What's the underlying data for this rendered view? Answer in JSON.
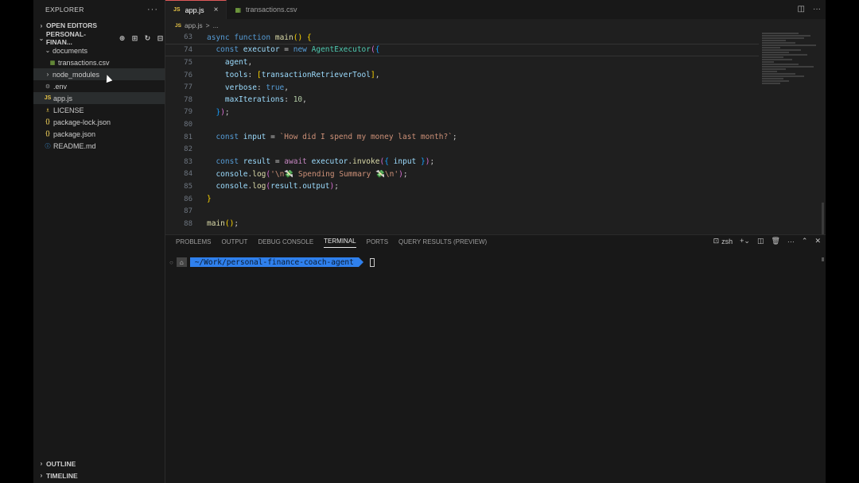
{
  "sidebar": {
    "title": "EXPLORER",
    "more": "···",
    "open_editors": "OPEN EDITORS",
    "project": "PERSONAL-FINAN...",
    "tree": [
      {
        "label": "documents",
        "type": "folder-open",
        "icon": "",
        "indent": 1
      },
      {
        "label": "transactions.csv",
        "type": "file",
        "icon": "▦",
        "indent": 2
      },
      {
        "label": "node_modules",
        "type": "folder-closed",
        "icon": "",
        "indent": 1
      },
      {
        "label": ".env",
        "type": "file",
        "icon": "⚙",
        "indent": 1
      },
      {
        "label": "app.js",
        "type": "file",
        "icon": "JS",
        "indent": 1
      },
      {
        "label": "LICENSE",
        "type": "file",
        "icon": "♗",
        "indent": 1
      },
      {
        "label": "package-lock.json",
        "type": "file",
        "icon": "{}",
        "indent": 1
      },
      {
        "label": "package.json",
        "type": "file",
        "icon": "{}",
        "indent": 1
      },
      {
        "label": "README.md",
        "type": "file",
        "icon": "ⓘ",
        "indent": 1
      }
    ],
    "outline": "OUTLINE",
    "timeline": "TIMELINE"
  },
  "tabs": [
    {
      "label": "app.js",
      "icon": "JS",
      "active": true,
      "close": "×"
    },
    {
      "label": "transactions.csv",
      "icon": "▦",
      "active": false
    }
  ],
  "breadcrumb": {
    "file": "app.js",
    "sep": ">",
    "rest": "..."
  },
  "code": {
    "lines": [
      {
        "n": "63",
        "text": "async function main() {",
        "sticky": true
      },
      {
        "n": "74",
        "text": "  const executor = new AgentExecutor({",
        "sticky": true
      },
      {
        "n": "75",
        "text": "    agent,"
      },
      {
        "n": "76",
        "text": "    tools: [transactionRetrieverTool],"
      },
      {
        "n": "77",
        "text": "    verbose: true,"
      },
      {
        "n": "78",
        "text": "    maxIterations: 10,"
      },
      {
        "n": "79",
        "text": "  });"
      },
      {
        "n": "80",
        "text": ""
      },
      {
        "n": "81",
        "text": "  const input = `How did I spend my money last month?`;"
      },
      {
        "n": "82",
        "text": ""
      },
      {
        "n": "83",
        "text": "  const result = await executor.invoke({ input });"
      },
      {
        "n": "84",
        "text": "  console.log('\\n💸 Spending Summary 💸\\n');"
      },
      {
        "n": "85",
        "text": "  console.log(result.output);"
      },
      {
        "n": "86",
        "text": "}"
      },
      {
        "n": "87",
        "text": ""
      },
      {
        "n": "88",
        "text": "main();"
      }
    ]
  },
  "panel": {
    "tabs": [
      "PROBLEMS",
      "OUTPUT",
      "DEBUG CONSOLE",
      "TERMINAL",
      "PORTS",
      "QUERY RESULTS (PREVIEW)"
    ],
    "active_tab": "TERMINAL",
    "shell": "zsh",
    "prompt_path": "~/Work/personal-finance-coach-agent"
  }
}
